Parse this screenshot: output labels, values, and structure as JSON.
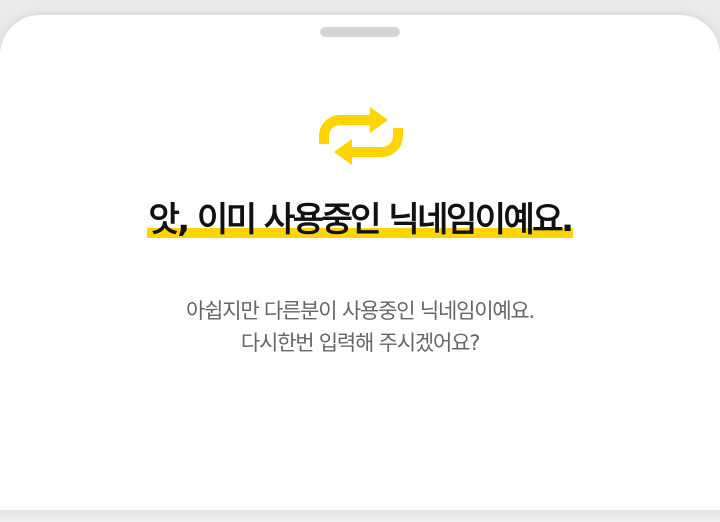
{
  "dialog": {
    "icon": "repeat-arrows-icon",
    "title": "앗, 이미 사용중인 닉네임이예요.",
    "message_line1": "아쉽지만 다른분이 사용중인 닉네임이예요.",
    "message_line2": "다시한번 입력해 주시겠어요?"
  },
  "colors": {
    "accent": "#ffd400",
    "title_text": "#111111",
    "body_text": "#666666",
    "background": "#ffffff"
  }
}
